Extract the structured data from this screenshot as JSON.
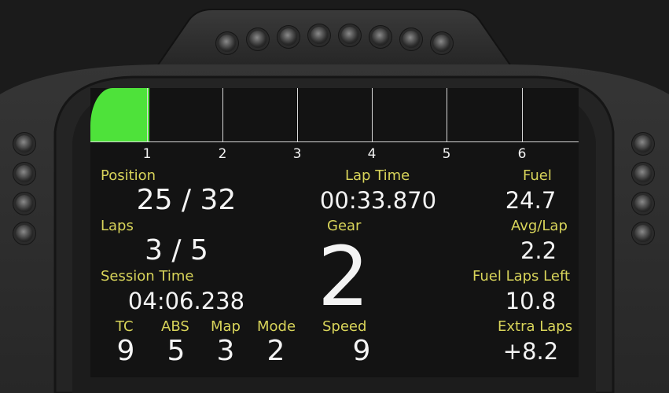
{
  "rpm": {
    "fill_fraction": 0.12,
    "markers": [
      "1",
      "2",
      "3",
      "4",
      "5",
      "6"
    ],
    "fill_color": "#4ee23a"
  },
  "labels": {
    "position": "Position",
    "laps": "Laps",
    "session_time": "Session Time",
    "tc": "TC",
    "abs": "ABS",
    "map": "Map",
    "mode": "Mode",
    "lap_time": "Lap Time",
    "gear": "Gear",
    "speed": "Speed",
    "fuel": "Fuel",
    "avg_lap": "Avg/Lap",
    "fuel_laps_left": "Fuel Laps Left",
    "extra_laps": "Extra Laps"
  },
  "values": {
    "position": "25 / 32",
    "laps": "3 / 5",
    "session_time": "04:06.238",
    "tc": "9",
    "abs": "5",
    "map": "3",
    "mode": "2",
    "lap_time": "00:33.870",
    "gear": "2",
    "speed": "9",
    "fuel": "24.7",
    "avg_lap": "2.2",
    "fuel_laps_left": "10.8",
    "extra_laps": "+8.2"
  },
  "colors": {
    "label": "#d8d45a",
    "value": "#f4f4f4",
    "screen": "#131313"
  }
}
